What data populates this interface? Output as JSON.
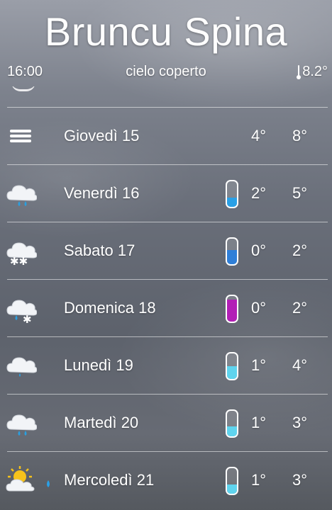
{
  "header": {
    "title": "Bruncu Spina",
    "time": "16:00",
    "condition": "cielo coperto",
    "current_temp": "8.2°"
  },
  "days": [
    {
      "label": "Giovedì 15",
      "min": "4°",
      "max": "8°",
      "icon": "fog-icon",
      "precip": null,
      "precip_color": null
    },
    {
      "label": "Venerdì 16",
      "min": "2°",
      "max": "5°",
      "icon": "cloud-rain-icon",
      "precip": 0.35,
      "precip_color": "#2aa0e6"
    },
    {
      "label": "Sabato 17",
      "min": "0°",
      "max": "2°",
      "icon": "cloud-snow-icon",
      "precip": 0.55,
      "precip_color": "#2f7fd8"
    },
    {
      "label": "Domenica 18",
      "min": "0°",
      "max": "2°",
      "icon": "cloud-sleet-icon",
      "precip": 0.85,
      "precip_color": "#b21fb6"
    },
    {
      "label": "Lunedì 19",
      "min": "1°",
      "max": "4°",
      "icon": "cloud-drizzle-icon",
      "precip": 0.5,
      "precip_color": "#5fd4ee"
    },
    {
      "label": "Martedì 20",
      "min": "1°",
      "max": "3°",
      "icon": "cloud-rain-icon",
      "precip": 0.4,
      "precip_color": "#5fd4ee"
    },
    {
      "label": "Mercoledì 21",
      "min": "1°",
      "max": "3°",
      "icon": "sun-cloud-icon",
      "precip": 0.35,
      "precip_color": "#5fd4ee"
    }
  ]
}
